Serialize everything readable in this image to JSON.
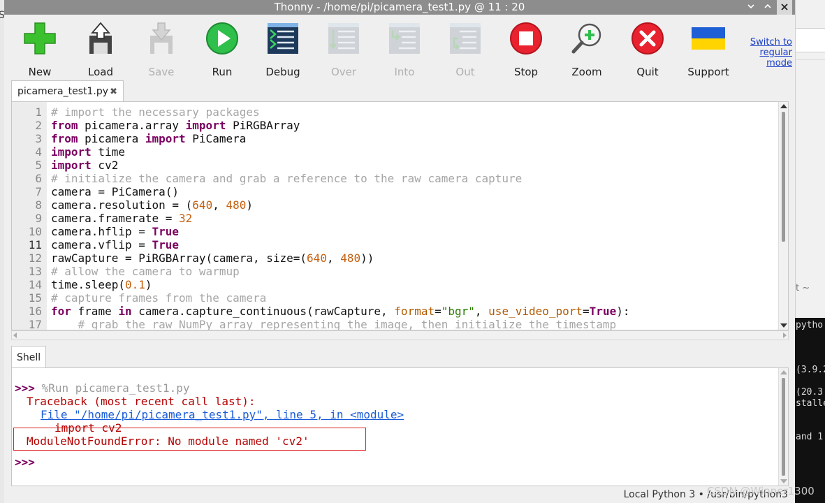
{
  "window": {
    "title": "Thonny  -  /home/pi/picamera_test1.py  @  11 : 20",
    "buttons": [
      "minimize",
      "maximize",
      "close"
    ]
  },
  "toolbar": {
    "items": [
      {
        "label": "New",
        "icon": "new-file-icon",
        "enabled": true
      },
      {
        "label": "Load",
        "icon": "load-icon",
        "enabled": true
      },
      {
        "label": "Save",
        "icon": "save-icon",
        "enabled": false
      },
      {
        "label": "Run",
        "icon": "run-icon",
        "enabled": true
      },
      {
        "label": "Debug",
        "icon": "debug-icon",
        "enabled": true
      },
      {
        "label": "Over",
        "icon": "step-over-icon",
        "enabled": false
      },
      {
        "label": "Into",
        "icon": "step-into-icon",
        "enabled": false
      },
      {
        "label": "Out",
        "icon": "step-out-icon",
        "enabled": false
      },
      {
        "label": "Stop",
        "icon": "stop-icon",
        "enabled": true
      },
      {
        "label": "Zoom",
        "icon": "zoom-icon",
        "enabled": true
      },
      {
        "label": "Quit",
        "icon": "quit-icon",
        "enabled": true
      },
      {
        "label": "Support",
        "icon": "ukraine-flag-icon",
        "enabled": true
      }
    ],
    "switch_mode_link": "Switch to regular mode"
  },
  "editor": {
    "tab_label": "picamera_test1.py",
    "current_line": 11,
    "lines": [
      "# import the necessary packages",
      "from picamera.array import PiRGBArray",
      "from picamera import PiCamera",
      "import time",
      "import cv2",
      "# initialize the camera and grab a reference to the raw camera capture",
      "camera = PiCamera()",
      "camera.resolution = (640, 480)",
      "camera.framerate = 32",
      "camera.hflip = True",
      "camera.vflip = True",
      "rawCapture = PiRGBArray(camera, size=(640, 480))",
      "# allow the camera to warmup",
      "time.sleep(0.1)",
      "# capture frames from the camera",
      "for frame in camera.capture_continuous(rawCapture, format=\"bgr\", use_video_port=True):",
      "    # grab the raw NumPy array representing the image, then initialize the timestamp"
    ]
  },
  "shell": {
    "tab_label": "Shell",
    "prompt": ">>>",
    "command": "%Run picamera_test1.py",
    "traceback_header": "Traceback (most recent call last):",
    "file_link": "File \"/home/pi/picamera_test1.py\", line 5, in <module>",
    "source_line": "import cv2",
    "error": "ModuleNotFoundError: No module named 'cv2'",
    "final_prompt": ">>>"
  },
  "status": {
    "interpreter": "Local Python 3  •  /usr/bin/python3"
  },
  "watermark": "CSDN @Winner1300",
  "background_terminal": {
    "lines": [
      "pytho",
      "(3.9.2",
      "(20.3",
      "stalle",
      "and 1"
    ],
    "prompt_fragment": "t ~",
    "left_fragment": "S"
  },
  "colors": {
    "titlebar": "#8d8d8d",
    "keyword": "#7a0060",
    "comment": "#a6a6a6",
    "number": "#c5600f",
    "string": "#297a00",
    "error": "#b50000",
    "link": "#1a5bd8"
  }
}
